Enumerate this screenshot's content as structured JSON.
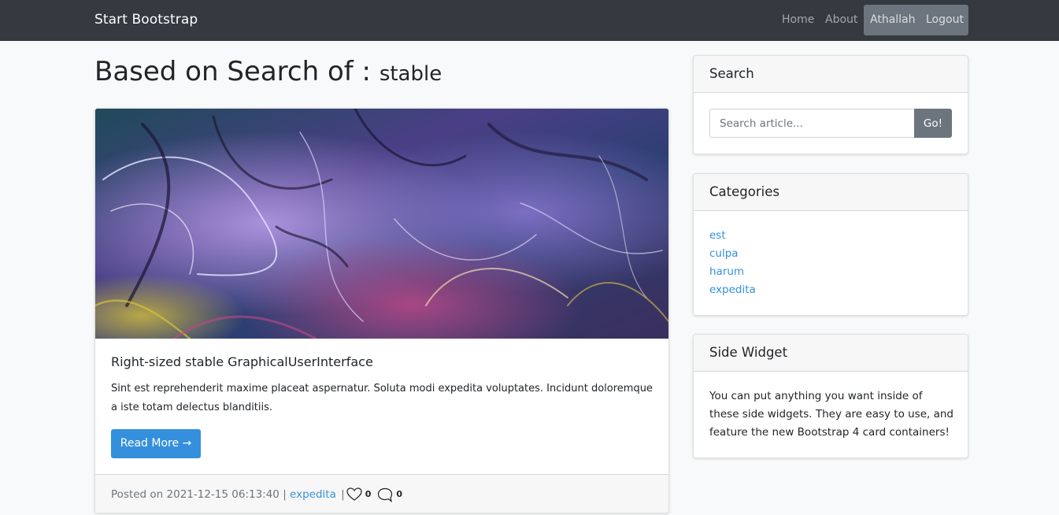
{
  "navbar": {
    "brand": "Start Bootstrap",
    "links": [
      {
        "label": "Home",
        "active": false
      },
      {
        "label": "About",
        "active": false
      },
      {
        "label": "Athallah",
        "active": true
      },
      {
        "label": "Logout",
        "active": true
      }
    ]
  },
  "heading": {
    "prefix": "Based on Search of : ",
    "query": "stable"
  },
  "post": {
    "title": "Right-sized stable GraphicalUserInterface",
    "excerpt": "Sint est reprehenderit maxime placeat aspernatur. Soluta modi expedita voluptates. Incidunt doloremque a iste totam delectus blanditiis.",
    "read_more_label": "Read More →",
    "posted_prefix": "Posted on 2021-12-15 06:13:40 |",
    "author": "expedita",
    "separator": "|",
    "likes": "0",
    "comments": "0",
    "like_icon": "heart-outline-icon",
    "comment_icon": "speech-bubble-icon"
  },
  "sidebar": {
    "search": {
      "title": "Search",
      "placeholder": "Search article...",
      "value": "",
      "button_label": "Go!"
    },
    "categories": {
      "title": "Categories",
      "items": [
        "est",
        "culpa",
        "harum",
        "expedita"
      ]
    },
    "widget": {
      "title": "Side Widget",
      "text": "You can put anything you want inside of these side widgets. They are easy to use, and feature the new Bootstrap 4 card containers!"
    }
  },
  "colors": {
    "navbar_bg": "#343a40",
    "link": "#3490dc",
    "primary_button": "#3490dc",
    "secondary_button": "#6c757d",
    "page_bg": "#f8f9fa"
  }
}
